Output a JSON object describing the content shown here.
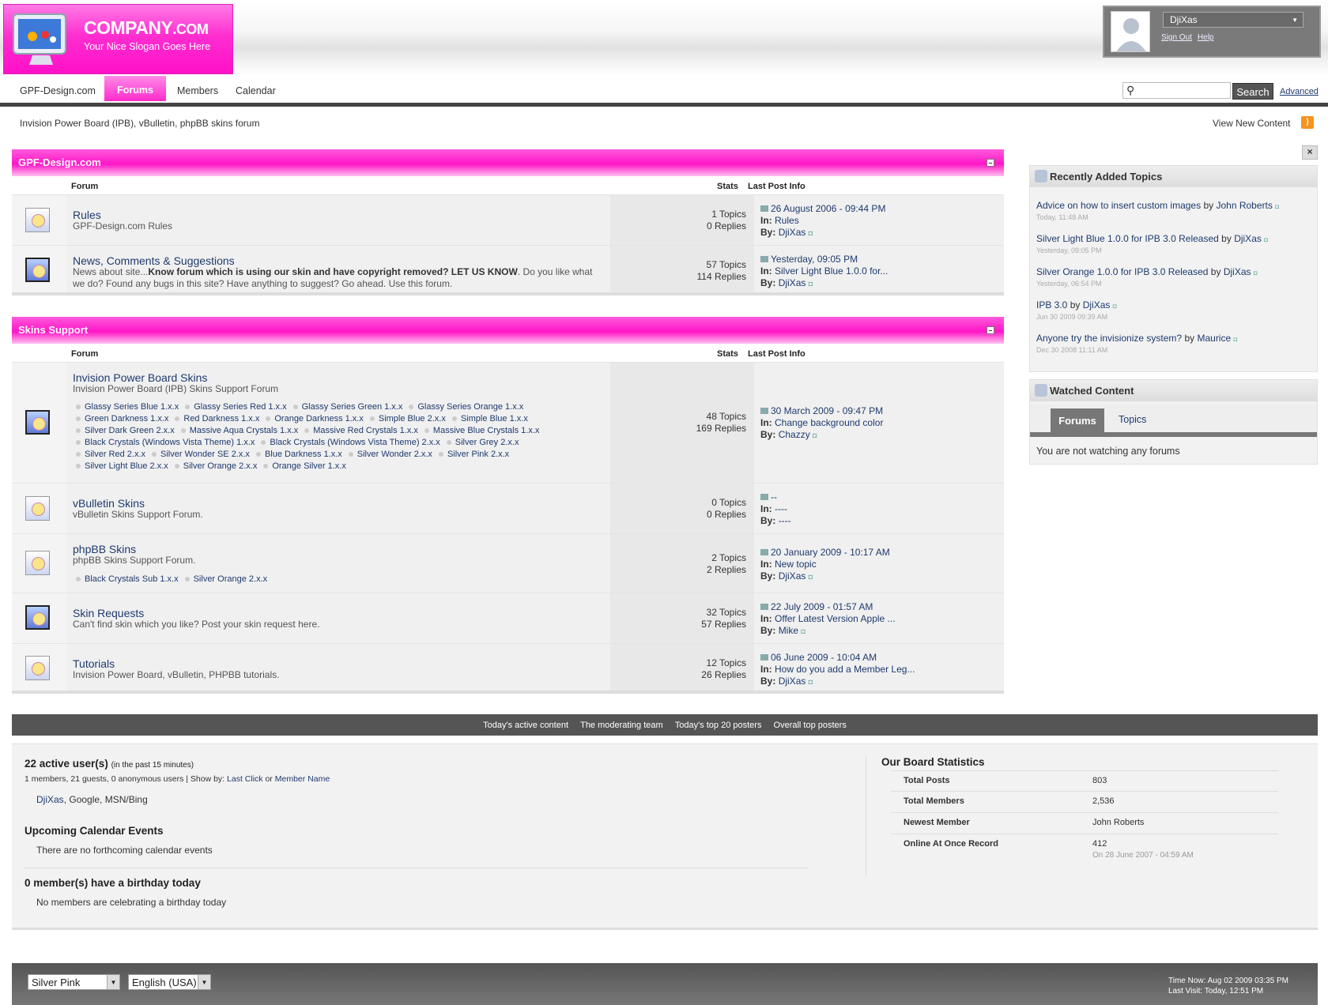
{
  "header": {
    "logo_title": "COMPANY",
    "logo_tld": ".COM",
    "logo_slogan": "Your Nice Slogan Goes Here",
    "user_name": "DjiXas",
    "sign_out": "Sign Out",
    "help": "Help"
  },
  "nav": {
    "items": [
      "GPF-Design.com",
      "Forums",
      "Members",
      "Calendar"
    ],
    "search_button": "Search",
    "advanced": "Advanced"
  },
  "breadcrumb": "Invision Power Board (IPB), vBulletin, phpBB skins forum",
  "view_new_content": "View New Content",
  "columns": {
    "forum": "Forum",
    "stats": "Stats",
    "last_post": "Last Post Info"
  },
  "categories": [
    {
      "title": "GPF-Design.com",
      "forums": [
        {
          "name": "Rules",
          "desc": "GPF-Design.com Rules",
          "topics": "1 Topics",
          "replies": "0 Replies",
          "date": "26 August 2006 - 09:44 PM",
          "in": "Rules",
          "by": "DjiXas"
        },
        {
          "name": "News, Comments & Suggestions",
          "desc_pre": "News about site...",
          "desc_bold": "Know forum which is using our skin and have copyright removed? LET US KNOW",
          "desc_post": ". Do you like what we do? Found any bugs in this site? Have anything to suggest? Go ahead. Use this forum.",
          "topics": "57 Topics",
          "replies": "114 Replies",
          "date": "Yesterday, 09:05 PM",
          "in": "Silver Light Blue 1.0.0 for...",
          "by": "DjiXas"
        }
      ]
    },
    {
      "title": "Skins Support",
      "forums": [
        {
          "name": "Invision Power Board Skins",
          "desc": "Invision Power Board (IPB) Skins Support Forum",
          "topics": "48 Topics",
          "replies": "169 Replies",
          "date": "30 March 2009 - 09:47 PM",
          "in": "Change background color",
          "by": "Chazzy",
          "subforums": [
            "Glassy Series Blue 1.x.x",
            "Glassy Series Red 1.x.x",
            "Glassy Series Green 1.x.x",
            "Glassy Series Orange 1.x.x",
            "Green Darkness 1.x.x",
            "Red Darkness 1.x.x",
            "Orange Darkness 1.x.x",
            "Simple Blue 2.x.x",
            "Simple Blue 1.x.x",
            "Silver Dark Green 2.x.x",
            "Massive Aqua Crystals 1.x.x",
            "Massive Red Crystals 1.x.x",
            "Massive Blue Crystals 1.x.x",
            "Black Crystals (Windows Vista Theme) 1.x.x",
            "Black Crystals (Windows Vista Theme) 2.x.x",
            "Silver Grey 2.x.x",
            "Silver Red 2.x.x",
            "Silver Wonder SE 2.x.x",
            "Blue Darkness 1.x.x",
            "Silver Wonder 2.x.x",
            "Silver Pink 2.x.x",
            "Silver Light Blue 2.x.x",
            "Silver Orange 2.x.x",
            "Orange Silver 1.x.x"
          ]
        },
        {
          "name": "vBulletin Skins",
          "desc": "vBulletin Skins Support Forum.",
          "topics": "0 Topics",
          "replies": "0 Replies",
          "date": "--",
          "in": "----",
          "by": "----"
        },
        {
          "name": "phpBB Skins",
          "desc": "phpBB Skins Support Forum.",
          "topics": "2 Topics",
          "replies": "2 Replies",
          "date": "20 January 2009 - 10:17 AM",
          "in": "New topic",
          "by": "DjiXas",
          "subforums": [
            "Black Crystals Sub 1.x.x",
            "Silver Orange 2.x.x"
          ]
        },
        {
          "name": "Skin Requests",
          "desc": "Can't find skin which you like? Post your skin request here.",
          "topics": "32 Topics",
          "replies": "57 Replies",
          "date": "22 July 2009 - 01:57 AM",
          "in": "Offer Latest Version Apple ...",
          "by": "Mike"
        },
        {
          "name": "Tutorials",
          "desc": "Invision Power Board, vBulletin, PHPBB tutorials.",
          "topics": "12 Topics",
          "replies": "26 Replies",
          "date": "06 June 2009 - 10:04 AM",
          "in": "How do you add a Member Leg...",
          "by": "DjiXas"
        }
      ]
    }
  ],
  "labels": {
    "in": "In:",
    "by": "By:"
  },
  "sidebar": {
    "close": "×",
    "recent_title": "Recently Added Topics",
    "recent": [
      {
        "topic": "Advice on how to insert custom images",
        "by": "by",
        "author": "John Roberts",
        "date": "Today, 11:48 AM"
      },
      {
        "topic": "Silver Light Blue 1.0.0 for IPB 3.0 Released",
        "by": "by",
        "author": "DjiXas",
        "date": "Yesterday, 09:05 PM"
      },
      {
        "topic": "Silver Orange 1.0.0 for IPB 3.0 Released",
        "by": "by",
        "author": "DjiXas",
        "date": "Yesterday, 06:54 PM"
      },
      {
        "topic": "IPB 3.0",
        "by": "by",
        "author": "DjiXas",
        "date": "Jun 30 2009 09:39 AM"
      },
      {
        "topic": "Anyone try the invisionize system?",
        "by": "by",
        "author": "Maurice",
        "date": "Dec 30 2008 11:11 AM"
      }
    ],
    "watched_title": "Watched Content",
    "tab_forums": "Forums",
    "tab_topics": "Topics",
    "watched_msg": "You are not watching any forums"
  },
  "statsbar": [
    "Today's active content",
    "The moderating team",
    "Today's top 20 posters",
    "Overall top posters"
  ],
  "stats": {
    "active_title": "22 active user(s)",
    "active_note": "(in the past 15 minutes)",
    "active_detail": "1 members, 21 guests, 0 anonymous users | Show by:",
    "last_click": "Last Click",
    "or": "or",
    "member_name": "Member Name",
    "active_member": "DjiXas",
    "active_rest": ", Google, MSN/Bing",
    "calendar_title": "Upcoming Calendar Events",
    "calendar_msg": "There are no forthcoming calendar events",
    "birthday_title": "0 member(s) have a birthday today",
    "birthday_msg": "No members are celebrating a birthday today",
    "board_title": "Our Board Statistics",
    "board": [
      {
        "k": "Total Posts",
        "v": "803"
      },
      {
        "k": "Total Members",
        "v": "2,536"
      },
      {
        "k": "Newest Member",
        "v": "John Roberts"
      },
      {
        "k": "Online At Once Record",
        "v": "412",
        "sub": "On 28 June 2007 - 04:59 AM"
      }
    ]
  },
  "footer": {
    "skin": "Silver Pink",
    "lang": "English (USA)",
    "time_now": "Time Now: Aug 02 2009 03:35 PM",
    "last_visit": "Last Visit: Today, 12:51 PM"
  },
  "colors": {
    "accent": "#ff1fc9",
    "link": "#1f3a6e",
    "dark_bar": "#555555"
  },
  "icons": [
    "user-avatar-icon",
    "search-icon",
    "rss-icon",
    "forum-icon",
    "forum-new-icon",
    "last-post-arrow-icon",
    "external-link-icon",
    "collapse-icon",
    "close-icon",
    "recent-topics-icon",
    "watched-icon"
  ]
}
